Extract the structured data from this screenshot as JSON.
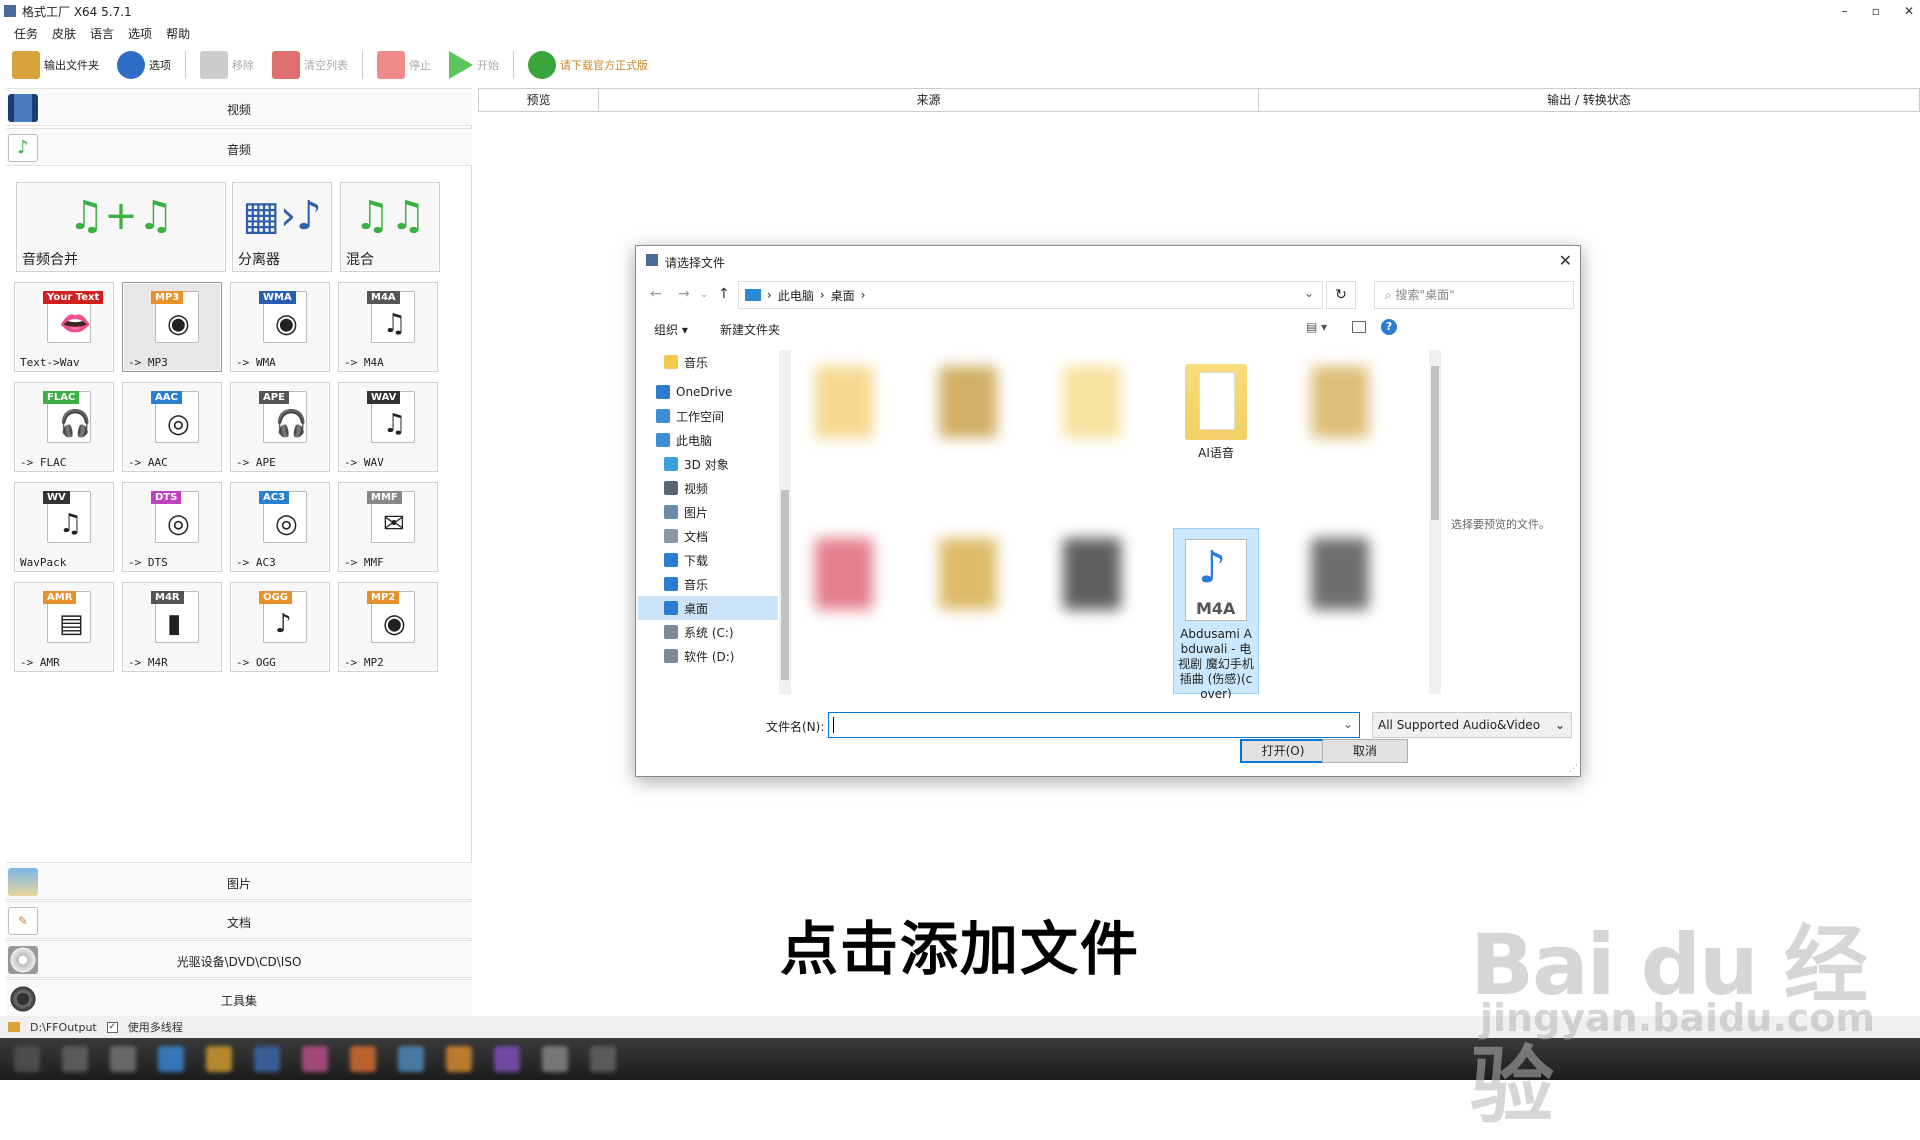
{
  "app": {
    "title": "格式工厂 X64 5.7.1",
    "window_controls": [
      "–",
      "▫",
      "✕"
    ]
  },
  "menu": [
    "任务",
    "皮肤",
    "语言",
    "选项",
    "帮助"
  ],
  "toolbar": [
    {
      "label": "输出文件夹",
      "icon": "folder-icon",
      "enabled": true,
      "color": "#d9a23a"
    },
    {
      "label": "选项",
      "icon": "gear-icon",
      "enabled": true,
      "color": "#2b6cc4"
    },
    {
      "label": "移除",
      "icon": "remove-icon",
      "enabled": false,
      "color": "#cccccc"
    },
    {
      "label": "清空列表",
      "icon": "clear-list-icon",
      "enabled": false,
      "color": "#e07070"
    },
    {
      "label": "停止",
      "icon": "stop-icon",
      "enabled": false,
      "color": "#f08a8a"
    },
    {
      "label": "开始",
      "icon": "play-icon",
      "enabled": false,
      "color": "#5cc45c"
    },
    {
      "label": "请下载官方正式版",
      "icon": "download-icon",
      "enabled": true,
      "color": "#3aa53a",
      "text_color": "#c8862a"
    }
  ],
  "categories": {
    "video": "视频",
    "audio": "音频",
    "picture": "图片",
    "document": "文档",
    "disc": "光驱设备\\DVD\\CD\\ISO",
    "tools": "工具集"
  },
  "big_tiles": [
    {
      "label": "音频合并",
      "glyph": "♫+♫",
      "color": "#3cb043"
    },
    {
      "label": "分离器",
      "glyph": "▦›♪",
      "color": "#2d5fa8"
    },
    {
      "label": "混合",
      "glyph": "♫♫",
      "color": "#3cb043"
    }
  ],
  "tiles": [
    {
      "label": "Text->Wav",
      "badge": "Your Text",
      "badge_color": "#d12020",
      "glyph": "👄"
    },
    {
      "label": "-> MP3",
      "badge": "MP3",
      "badge_color": "#e8902a",
      "glyph": "◉",
      "selected": true
    },
    {
      "label": "-> WMA",
      "badge": "WMA",
      "badge_color": "#2a5fb0",
      "glyph": "◉"
    },
    {
      "label": "-> M4A",
      "badge": "M4A",
      "badge_color": "#555555",
      "glyph": "♫"
    },
    {
      "label": "-> FLAC",
      "badge": "FLAC",
      "badge_color": "#3cb043",
      "glyph": "🎧"
    },
    {
      "label": "-> AAC",
      "badge": "AAC",
      "badge_color": "#2a80d0",
      "glyph": "◎"
    },
    {
      "label": "-> APE",
      "badge": "APE",
      "badge_color": "#555555",
      "glyph": "🎧"
    },
    {
      "label": "-> WAV",
      "badge": "WAV",
      "badge_color": "#333333",
      "glyph": "♫"
    },
    {
      "label": "WavPack",
      "badge": "WV",
      "badge_color": "#333333",
      "glyph": "♫"
    },
    {
      "label": "-> DTS",
      "badge": "DTS",
      "badge_color": "#c040c0",
      "glyph": "◎"
    },
    {
      "label": "-> AC3",
      "badge": "AC3",
      "badge_color": "#2a80d0",
      "glyph": "◎"
    },
    {
      "label": "-> MMF",
      "badge": "MMF",
      "badge_color": "#888888",
      "glyph": "✉"
    },
    {
      "label": "-> AMR",
      "badge": "AMR",
      "badge_color": "#e8902a",
      "glyph": "▤"
    },
    {
      "label": "-> M4R",
      "badge": "M4R",
      "badge_color": "#555555",
      "glyph": "▮"
    },
    {
      "label": "-> OGG",
      "badge": "OGG",
      "badge_color": "#e8902a",
      "glyph": "♪"
    },
    {
      "label": "-> MP2",
      "badge": "MP2",
      "badge_color": "#e8902a",
      "glyph": "◉"
    }
  ],
  "output_headers": [
    "预览",
    "来源",
    "输出 / 转换状态"
  ],
  "status": {
    "output_path": "D:\\FFOutput",
    "multithread": "使用多线程"
  },
  "dialog": {
    "title": "请选择文件",
    "breadcrumb": [
      "此电脑",
      "桌面"
    ],
    "search_placeholder": "搜索\"桌面\"",
    "organize": "组织 ▾",
    "new_folder": "新建文件夹",
    "help": "?",
    "nav_items": [
      {
        "label": "音乐",
        "color": "#f2c84b",
        "indent": 1
      },
      {
        "label": "OneDrive",
        "color": "#2b7cd3",
        "indent": 0
      },
      {
        "label": "工作空间",
        "color": "#3a8fd8",
        "indent": 0
      },
      {
        "label": "此电脑",
        "color": "#3a8fd8",
        "indent": 0
      },
      {
        "label": "3D 对象",
        "color": "#3aa0e0",
        "indent": 1
      },
      {
        "label": "视频",
        "color": "#556677",
        "indent": 1
      },
      {
        "label": "图片",
        "color": "#6a8aa8",
        "indent": 1
      },
      {
        "label": "文档",
        "color": "#8899aa",
        "indent": 1
      },
      {
        "label": "下载",
        "color": "#2b7cd3",
        "indent": 1
      },
      {
        "label": "音乐",
        "color": "#2b7cd3",
        "indent": 1
      },
      {
        "label": "桌面",
        "color": "#2b7cd3",
        "indent": 1,
        "selected": true
      },
      {
        "label": "系统 (C:)",
        "color": "#7a8a9a",
        "indent": 1
      },
      {
        "label": "软件 (D:)",
        "color": "#7a8a9a",
        "indent": 1
      }
    ],
    "files": [
      {
        "label": "",
        "blurred": true,
        "color": "#f3d27a"
      },
      {
        "label": "",
        "blurred": true,
        "color": "#c9a24a"
      },
      {
        "label": "",
        "blurred": true,
        "color": "#f6dc8e"
      },
      {
        "label": "AI语音",
        "blurred": false,
        "color": "#f3cf66",
        "type": "folder"
      },
      {
        "label": "",
        "blurred": true,
        "color": "#d8b460"
      },
      {
        "label": "",
        "blurred": true,
        "color": "#e06a7a"
      },
      {
        "label": "",
        "blurred": true,
        "color": "#d8b050"
      },
      {
        "label": "",
        "blurred": true,
        "color": "#444444"
      },
      {
        "label": "Abdusami Abduwali - 电视剧 魔幻手机插曲 (伤感)(cover)",
        "blurred": false,
        "color": "#2b7cd3",
        "type": "m4a",
        "badge": "M4A",
        "selected": true
      },
      {
        "label": "",
        "blurred": true,
        "color": "#555555"
      }
    ],
    "preview_hint": "选择要预览的文件。",
    "filename_label": "文件名(N):",
    "filename_value": "",
    "filter": "All Supported Audio&Video",
    "open_button": "打开(O)",
    "cancel_button": "取消"
  },
  "caption": "点击添加文件",
  "watermark": {
    "brand": "Bai du 经验",
    "url": "jingyan.baidu.com"
  }
}
